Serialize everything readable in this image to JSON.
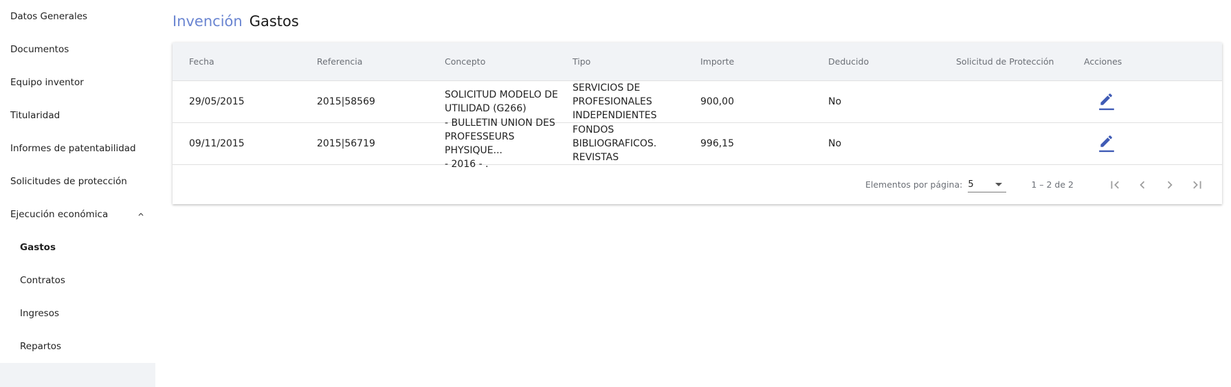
{
  "sidebar": {
    "items": [
      {
        "label": "Datos Generales"
      },
      {
        "label": "Documentos"
      },
      {
        "label": "Equipo inventor"
      },
      {
        "label": "Titularidad"
      },
      {
        "label": "Informes de patentabilidad"
      },
      {
        "label": "Solicitudes de protección"
      }
    ],
    "group": {
      "label": "Ejecución económica",
      "expanded": true,
      "children": [
        {
          "label": "Gastos",
          "active": true
        },
        {
          "label": "Contratos"
        },
        {
          "label": "Ingresos"
        },
        {
          "label": "Repartos"
        }
      ]
    }
  },
  "breadcrumb": {
    "parent": "Invención",
    "current": "Gastos"
  },
  "table": {
    "headers": [
      "Fecha",
      "Referencia",
      "Concepto",
      "Tipo",
      "Importe",
      "Deducido",
      "Solicitud de Protección",
      "Acciones"
    ],
    "rows": [
      {
        "fecha": "29/05/2015",
        "referencia": "2015|58569",
        "concepto": [
          "SOLICITUD MODELO DE",
          "UTILIDAD (G266)"
        ],
        "tipo": [
          "SERVICIOS DE",
          "PROFESIONALES",
          "INDEPENDIENTES"
        ],
        "importe": "900,00",
        "deducido": "No",
        "solicitud": ""
      },
      {
        "fecha": "09/11/2015",
        "referencia": "2015|56719",
        "concepto": [
          "- BULLETIN UNION DES",
          "PROFESSEURS PHYSIQUE...",
          "- 2016 - ."
        ],
        "tipo": [
          "FONDOS BIBLIOGRAFICOS.",
          "REVISTAS"
        ],
        "importe": "996,15",
        "deducido": "No",
        "solicitud": ""
      }
    ]
  },
  "paginator": {
    "items_per_page_label": "Elementos por página:",
    "page_size": "5",
    "range_label": "1 – 2 de 2"
  },
  "colors": {
    "accent": "#6a85d1",
    "icon": "#3f5bb5",
    "header_bg": "#f1f3f6"
  },
  "icons": {
    "edit": "pencil-icon",
    "collapse": "chevron-up-icon",
    "dropdown": "caret-down-icon",
    "first": "first-page-icon",
    "prev": "chevron-left-icon",
    "next": "chevron-right-icon",
    "last": "last-page-icon"
  }
}
